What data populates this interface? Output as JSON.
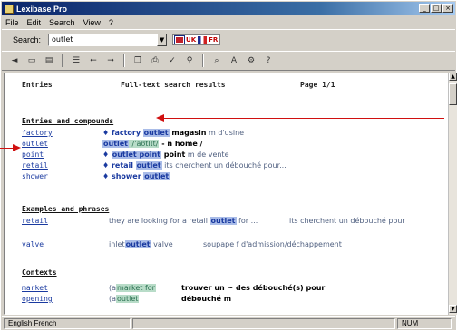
{
  "window": {
    "title": "Lexibase Pro"
  },
  "menu": [
    "File",
    "Edit",
    "Search",
    "View",
    "?"
  ],
  "search": {
    "label": "Search:",
    "value": "outlet"
  },
  "dict": {
    "from": "UK",
    "to": "FR"
  },
  "content": {
    "header": {
      "col1": "Entries",
      "col2": "Full-text search results",
      "col3": "Page 1/1"
    },
    "sections": {
      "entries_title": "Entries and compounds",
      "examples_title": "Examples and phrases",
      "contexts_title": "Contexts"
    },
    "entries": [
      {
        "link": "factory",
        "pre": "♦ factory",
        "hl": "outlet",
        "rest": " magasin",
        "tail": " m d'usine"
      },
      {
        "link": "outlet",
        "pre": "",
        "hl": "outlet",
        "rest": " /ˈaʊtlɪt/",
        "tail": " - n home /"
      },
      {
        "link": "point",
        "pre": "♦",
        "hl": "outlet point",
        "rest": " point",
        "tail": " m de vente"
      },
      {
        "link": "retail",
        "pre": "♦ retail",
        "hl": "outlet",
        "rest": " its cherchent un débouché pour...",
        "tail": ""
      },
      {
        "link": "shower",
        "pre": "♦ shower",
        "hl": "outlet",
        "rest": "",
        "tail": ""
      }
    ],
    "examples": [
      {
        "link": "retail",
        "pre": "they are looking for a retail",
        "hl": "outlet",
        "rest": " for ...",
        "tail": "its cherchent un débouché pour"
      },
      {
        "link": "valve",
        "pre": "inlet",
        "hl": "outlet",
        "rest": " valve",
        "tail": "soupape f d'admission/déchappement"
      }
    ],
    "contexts": [
      {
        "link": "market",
        "pre": "(a",
        "hl": "market for",
        "rest": "",
        "tail": "trouver un ~ des débouché(s) pour"
      },
      {
        "link": "opening",
        "pre": "(a",
        "hl": "outlet",
        "rest": "",
        "tail": "débouché m"
      }
    ]
  },
  "status": {
    "left": "English French",
    "right": "NUM"
  }
}
